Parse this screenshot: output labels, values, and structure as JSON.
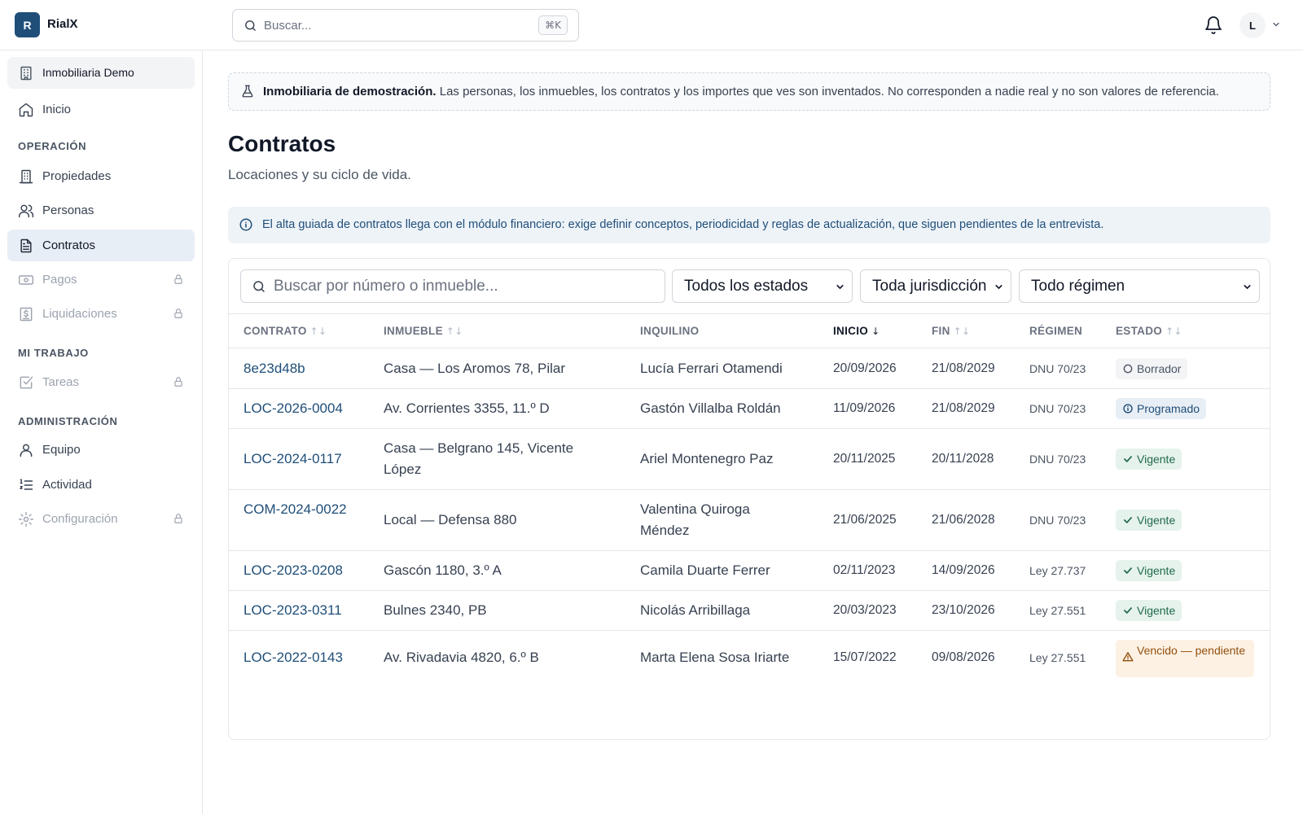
{
  "app": {
    "logo_letter": "R",
    "name": "RialX"
  },
  "topbar": {
    "search_placeholder": "Buscar...",
    "shortcut": "⌘K",
    "user_initial": "L"
  },
  "sidebar": {
    "org": "Inmobiliaria Demo",
    "home": "Inicio",
    "sections": {
      "operacion": "OPERACIÓN",
      "mi_trabajo": "MI TRABAJO",
      "admin": "ADMINISTRACIÓN"
    },
    "items": {
      "propiedades": "Propiedades",
      "personas": "Personas",
      "contratos": "Contratos",
      "pagos": "Pagos",
      "liquidaciones": "Liquidaciones",
      "tareas": "Tareas",
      "equipo": "Equipo",
      "actividad": "Actividad",
      "configuracion": "Configuración"
    }
  },
  "demo_banner": {
    "bold": "Inmobiliaria de demostración.",
    "text": " Las personas, los inmuebles, los contratos y los importes que ves son inventados. No corresponden a nadie real y no son valores de referencia."
  },
  "page": {
    "title": "Contratos",
    "subtitle": "Locaciones y su ciclo de vida."
  },
  "info_banner": "El alta guiada de contratos llega con el módulo financiero: exige definir conceptos, periodicidad y reglas de actualización, que siguen pendientes de la entrevista.",
  "filters": {
    "search_placeholder": "Buscar por número o inmueble...",
    "estado": "Todos los estados",
    "jurisdiccion": "Toda jurisdicción",
    "regimen": "Todo régimen"
  },
  "table": {
    "headers": {
      "contrato": "CONTRATO",
      "inmueble": "INMUEBLE",
      "inquilino": "INQUILINO",
      "inicio": "INICIO",
      "fin": "FIN",
      "regimen": "RÉGIMEN",
      "estado": "ESTADO"
    },
    "sort_icon": "↑↓",
    "sort_active_icon": "↓",
    "rows": [
      {
        "contrato": "8e23d48b",
        "inmueble": "Casa — Los Aromos 78, Pilar",
        "inquilino": "Lucía Ferrari Otamendi",
        "inicio": "20/09/2026",
        "fin": "21/08/2029",
        "regimen": "DNU 70/23",
        "estado": "Borrador"
      },
      {
        "contrato": "LOC-2026-0004",
        "inmueble": "Av. Corrientes 3355, 11.º D",
        "inquilino": "Gastón Villalba Roldán",
        "inicio": "11/09/2026",
        "fin": "21/08/2029",
        "regimen": "DNU 70/23",
        "estado": "Programado"
      },
      {
        "contrato": "LOC-2024-0117",
        "inmueble": "Casa — Belgrano 145, Vicente López",
        "inquilino": "Ariel Montenegro Paz",
        "inicio": "20/11/2025",
        "fin": "20/11/2028",
        "regimen": "DNU 70/23",
        "estado": "Vigente"
      },
      {
        "contrato": "COM-2024-0022",
        "inmueble": "Local — Defensa 880",
        "inquilino": "Valentina Quiroga Méndez",
        "inicio": "21/06/2025",
        "fin": "21/06/2028",
        "regimen": "DNU 70/23",
        "estado": "Vigente"
      },
      {
        "contrato": "LOC-2023-0208",
        "inmueble": "Gascón 1180, 3.º A",
        "inquilino": "Camila Duarte Ferrer",
        "inicio": "02/11/2023",
        "fin": "14/09/2026",
        "regimen": "Ley 27.737",
        "estado": "Vigente"
      },
      {
        "contrato": "LOC-2023-0311",
        "inmueble": "Bulnes 2340, PB",
        "inquilino": "Nicolás Arribillaga",
        "inicio": "20/03/2023",
        "fin": "23/10/2026",
        "regimen": "Ley 27.551",
        "estado": "Vigente"
      },
      {
        "contrato": "LOC-2022-0143",
        "inmueble": "Av. Rivadavia 4820, 6.º B",
        "inquilino": "Marta Elena Sosa Iriarte",
        "inicio": "15/07/2022",
        "fin": "09/08/2026",
        "regimen": "Ley 27.551",
        "estado": "Vencido — pendiente"
      }
    ]
  },
  "colors": {
    "brand": "#1f4e79",
    "active_bg": "#e8eef5",
    "green": "#1f6b4a",
    "amber": "#92510e"
  }
}
